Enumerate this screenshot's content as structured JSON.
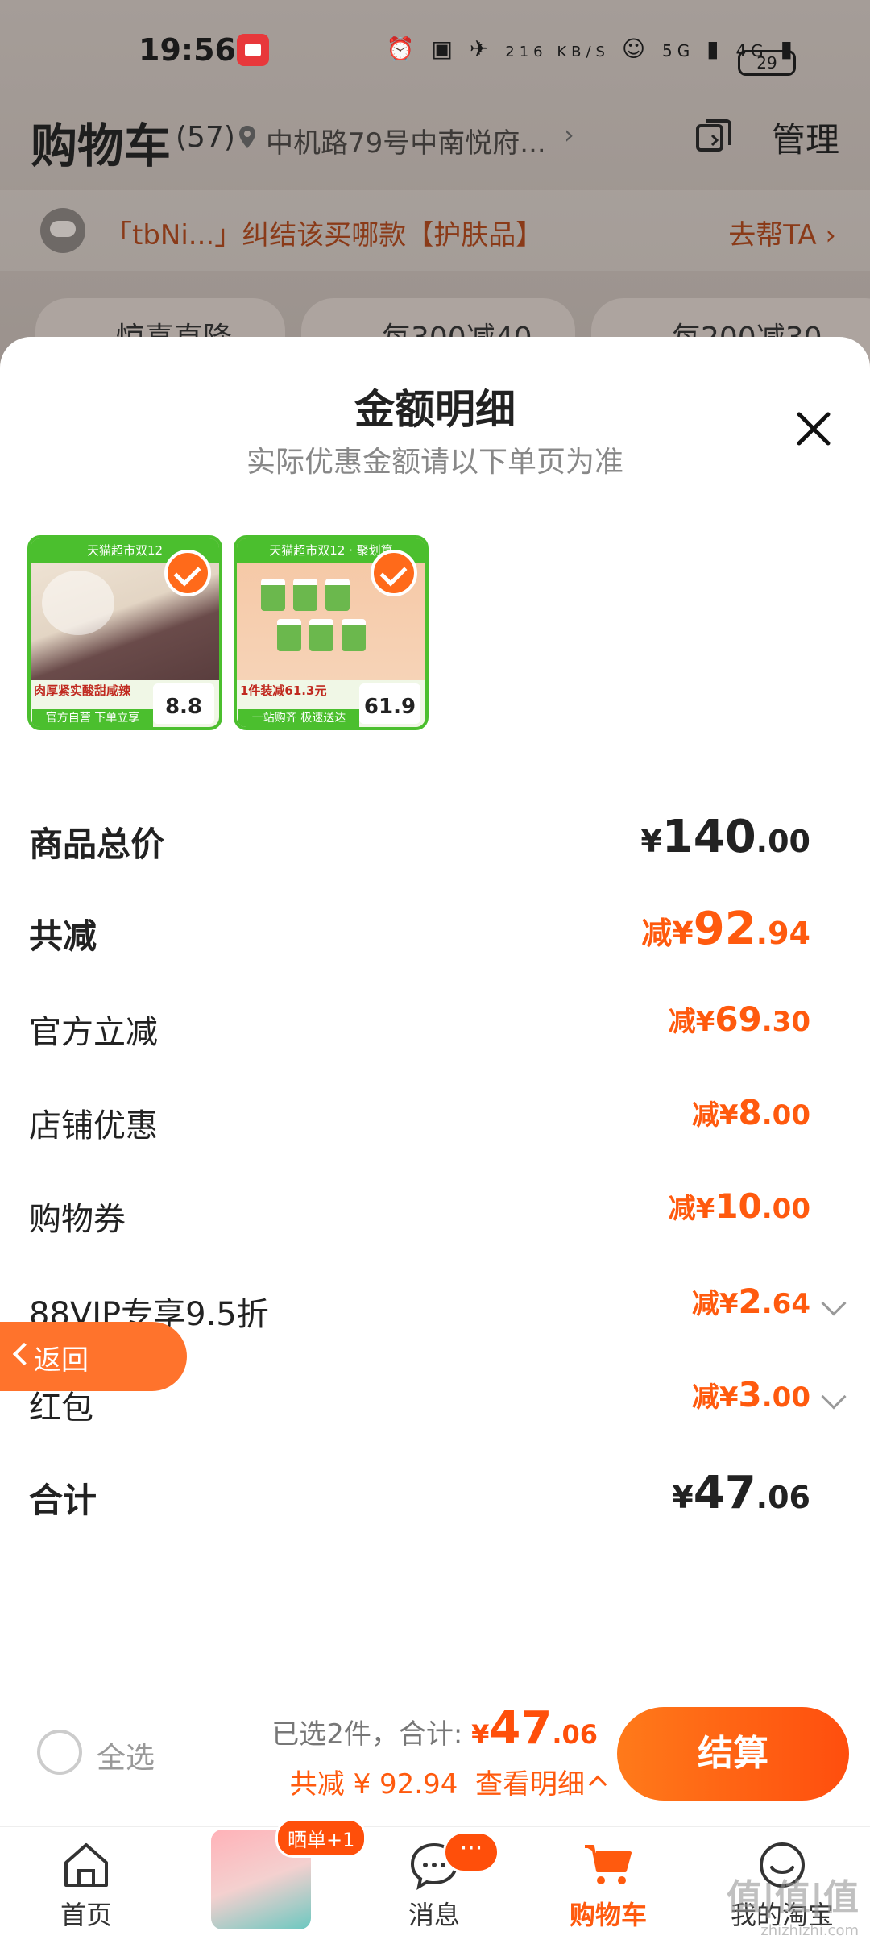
{
  "status_bar": {
    "time": "19:56",
    "net_speed": "216 KB/S",
    "net1": "5G",
    "net2": "4G",
    "battery": "29"
  },
  "header": {
    "title": "购物车",
    "count": "(57)",
    "address": "中机路79号中南悦府...",
    "manage_label": "管理"
  },
  "notice": {
    "text": "「tbNi...」纠结该买哪款【护肤品】",
    "action": "去帮TA"
  },
  "promos": [
    "惊喜直降",
    "每300减40",
    "每200减30"
  ],
  "sheet": {
    "title": "金额明细",
    "subtitle": "实际优惠金额请以下单页为准",
    "products": [
      {
        "header": "天猫超市双12",
        "label": "肉厚紧实酸甜咸辣",
        "tag": "官方自营 下单立享",
        "price": "8.8"
      },
      {
        "header": "天猫超市双12 · 聚划算",
        "label": "1件装减61.3元",
        "tag": "一站购齐 极速送达",
        "price": "61.9"
      }
    ],
    "rows": [
      {
        "label": "商品总价",
        "prefix": "¥",
        "int": "140",
        "dec": ".00"
      },
      {
        "label": "共减",
        "prefix": "减¥",
        "int": "92",
        "dec": ".94"
      },
      {
        "label": "官方立减",
        "prefix": "减¥",
        "int": "69",
        "dec": ".30"
      },
      {
        "label": "店铺优惠",
        "prefix": "减¥",
        "int": "8",
        "dec": ".00"
      },
      {
        "label": "购物券",
        "prefix": "减¥",
        "int": "10",
        "dec": ".00"
      },
      {
        "label": "88VIP专享9.5折",
        "prefix": "减¥",
        "int": "2",
        "dec": ".64"
      },
      {
        "label": "红包",
        "prefix": "减¥",
        "int": "3",
        "dec": ".00"
      },
      {
        "label": "合计",
        "prefix": "¥",
        "int": "47",
        "dec": ".06"
      }
    ]
  },
  "back_button": {
    "label": "返回"
  },
  "checkout": {
    "select_all": "全选",
    "selected": "已选2件，合计:",
    "currency": "¥",
    "total_int": "47",
    "total_dec": ".06",
    "reduce_text": "共减 ¥ 92.94",
    "detail_link": "查看明细",
    "pay_label": "结算"
  },
  "tabbar": {
    "items": [
      "首页",
      "消息",
      "购物车",
      "我的淘宝"
    ],
    "thumb_badge": "晒单+1",
    "msg_badge": "···"
  },
  "watermark": {
    "main": "值|值|值",
    "sub": "zhizhizhi.com"
  },
  "colors": {
    "accent": "#ff5a0e",
    "pay_gradient_start": "#ff7a1a",
    "pay_gradient_end": "#ff4e0e",
    "green_tag": "#4bbf2e"
  }
}
